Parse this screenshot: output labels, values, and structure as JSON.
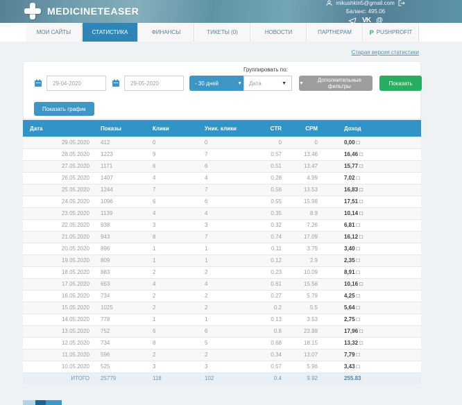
{
  "header": {
    "logo_text": "MEDICINETEASER",
    "user_email": "mikushkin5@gmail.com",
    "balance": "Баланс: 495.06",
    "vk_glyph": "VK",
    "at_glyph": "@"
  },
  "nav": {
    "tabs": [
      {
        "label": "МОИ САЙТЫ",
        "active": false
      },
      {
        "label": "СТАТИСТИКА",
        "active": true
      },
      {
        "label": "ФИНАНСЫ",
        "active": false
      },
      {
        "label": "ТИКЕТЫ (0)",
        "active": false
      },
      {
        "label": "НОВОСТИ",
        "active": false
      },
      {
        "label": "ПАРТНЕРАМ",
        "active": false
      },
      {
        "label": "PUSHPROFIT",
        "active": false,
        "icon": "pushprofit-icon",
        "icon_glyph": "P"
      }
    ]
  },
  "toolbar": {
    "old_stats_link": "Старая версия статистики",
    "date_from": "29-04-2020",
    "date_to": "29-05-2020",
    "period_value": "- 30 дней",
    "group_by_label": "Группировать по:",
    "group_by_value": "Дата",
    "extra_filters_button": "Дополнительные фильтры",
    "show_button": "Показать",
    "show_chart_button": "Показать график",
    "caret_glyph": "▼"
  },
  "table": {
    "columns": [
      "Дата",
      "Показы",
      "Клики",
      "Уник. клики",
      "CTR",
      "CPM",
      "Доход"
    ],
    "rows": [
      [
        "29.05.2020",
        "412",
        "0",
        "0",
        "0",
        "0",
        "0,00 □"
      ],
      [
        "28.05.2020",
        "1223",
        "9",
        "7",
        "0.57",
        "13.46",
        "16,46 □"
      ],
      [
        "27.05.2020",
        "1171",
        "6",
        "6",
        "0.51",
        "13.47",
        "15,77 □"
      ],
      [
        "26.05.2020",
        "1407",
        "4",
        "4",
        "0.28",
        "4.99",
        "7,02 □"
      ],
      [
        "25.05.2020",
        "1244",
        "7",
        "7",
        "0.56",
        "13.53",
        "16,83 □"
      ],
      [
        "24.05.2020",
        "1096",
        "6",
        "6",
        "0.55",
        "15.98",
        "17,51 □"
      ],
      [
        "23.05.2020",
        "1139",
        "4",
        "4",
        "0.35",
        "8.9",
        "10,14 □"
      ],
      [
        "22.05.2020",
        "938",
        "3",
        "3",
        "0.32",
        "7.26",
        "6,81 □"
      ],
      [
        "21.05.2020",
        "943",
        "8",
        "7",
        "0.74",
        "17.09",
        "16,12 □"
      ],
      [
        "20.05.2020",
        "896",
        "1",
        "1",
        "0.11",
        "3.79",
        "3,40 □"
      ],
      [
        "19.05.2020",
        "809",
        "1",
        "1",
        "0.12",
        "2.9",
        "2,35 □"
      ],
      [
        "18.05.2020",
        "883",
        "2",
        "2",
        "0.23",
        "10.09",
        "8,91 □"
      ],
      [
        "17.05.2020",
        "653",
        "4",
        "4",
        "0.61",
        "15.56",
        "10,16 □"
      ],
      [
        "16.05.2020",
        "734",
        "2",
        "2",
        "0.27",
        "5.79",
        "4,25 □"
      ],
      [
        "15.05.2020",
        "1025",
        "2",
        "2",
        "0.2",
        "5.5",
        "5,64 □"
      ],
      [
        "14.05.2020",
        "778",
        "1",
        "1",
        "0.13",
        "3.53",
        "2,75 □"
      ],
      [
        "13.05.2020",
        "752",
        "6",
        "6",
        "0.8",
        "23.88",
        "17,96 □"
      ],
      [
        "12.05.2020",
        "734",
        "8",
        "5",
        "0.68",
        "18.15",
        "13,32 □"
      ],
      [
        "11.05.2020",
        "596",
        "2",
        "2",
        "0.34",
        "13.07",
        "7,79 □"
      ],
      [
        "10.05.2020",
        "525",
        "3",
        "3",
        "0.57",
        "5.96",
        "3,43 □"
      ]
    ],
    "total_row": [
      "ИТОГО",
      "25779",
      "118",
      "102",
      "0.4",
      "9.92",
      "255.83"
    ]
  },
  "colors": {
    "header_teal": "#6f9fae",
    "active_tab_blue": "#2e86b8",
    "table_header_blue": "#3194c6",
    "button_blue": "#3e96c4",
    "button_green": "#27ae60",
    "button_gray": "#9d9d9d",
    "link_blue": "#4f93bb",
    "page_bg": "#eef2f5"
  }
}
